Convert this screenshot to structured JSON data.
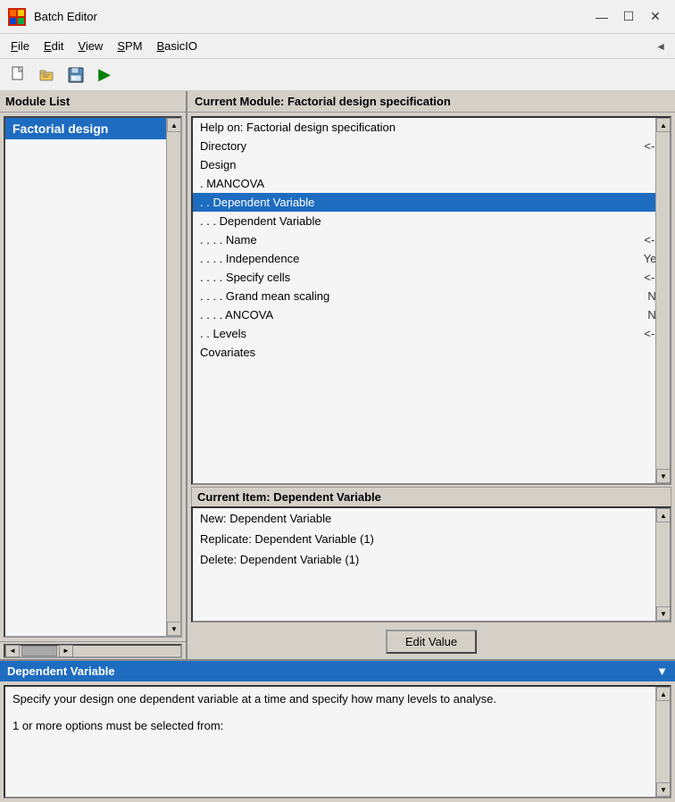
{
  "titleBar": {
    "title": "Batch Editor",
    "minimizeLabel": "—",
    "maximizeLabel": "☐",
    "closeLabel": "✕"
  },
  "menuBar": {
    "items": [
      {
        "label": "File",
        "underlineIndex": 0
      },
      {
        "label": "Edit",
        "underlineIndex": 0
      },
      {
        "label": "View",
        "underlineIndex": 0
      },
      {
        "label": "SPM",
        "underlineIndex": 0
      },
      {
        "label": "BasicIO",
        "underlineIndex": 0
      }
    ]
  },
  "toolbar": {
    "buttons": [
      {
        "name": "new-file-btn",
        "icon": "🗋",
        "label": "New"
      },
      {
        "name": "open-file-btn",
        "icon": "📂",
        "label": "Open"
      },
      {
        "name": "save-btn",
        "icon": "💾",
        "label": "Save"
      },
      {
        "name": "run-btn",
        "icon": "▶",
        "label": "Run"
      }
    ]
  },
  "moduleList": {
    "header": "Module List",
    "items": [
      {
        "label": "Factorial design"
      }
    ]
  },
  "currentModule": {
    "header": "Current Module: Factorial design specification",
    "items": [
      {
        "label": "Help on: Factorial design specification",
        "value": "",
        "selected": false
      },
      {
        "label": "Directory",
        "value": "<-X",
        "selected": false
      },
      {
        "label": "Design",
        "value": "",
        "selected": false
      },
      {
        "label": " . MANCOVA",
        "value": "",
        "selected": false
      },
      {
        "label": " . . Dependent Variable",
        "value": "",
        "selected": true
      },
      {
        "label": " . . . Dependent Variable",
        "value": "",
        "selected": false
      },
      {
        "label": " . . . . Name",
        "value": "<-X",
        "selected": false
      },
      {
        "label": " . . . . Independence",
        "value": "Yes",
        "selected": false
      },
      {
        "label": " . . . . Specify cells",
        "value": "<-X",
        "selected": false
      },
      {
        "label": " . . . . Grand mean scaling",
        "value": "No",
        "selected": false
      },
      {
        "label": " . . . . ANCOVA",
        "value": "No",
        "selected": false
      },
      {
        "label": " . . Levels",
        "value": "<-X",
        "selected": false
      },
      {
        "label": "Covariates",
        "value": "",
        "selected": false
      }
    ]
  },
  "currentItem": {
    "header": "Current Item: Dependent Variable",
    "items": [
      {
        "label": "New: Dependent Variable"
      },
      {
        "label": "Replicate: Dependent Variable (1)"
      },
      {
        "label": "Delete: Dependent Variable (1)"
      }
    ]
  },
  "editValueButton": "Edit Value",
  "bottomPanel": {
    "header": "Dependent Variable",
    "scrollIcon": "▼",
    "content": "Specify  your design one dependent variable at a time and specify how many levels to analyse.",
    "footer": "1 or more options must be selected from:"
  }
}
